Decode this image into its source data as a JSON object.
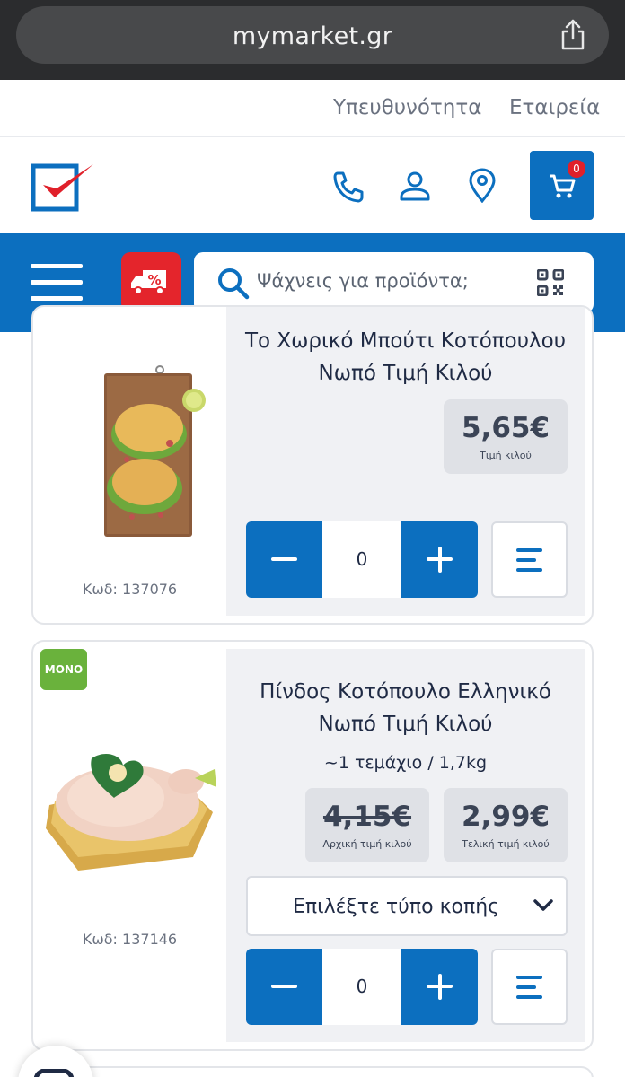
{
  "browser": {
    "url": "mymarket.gr"
  },
  "top_links": {
    "responsibility": "Υπευθυνότητα",
    "company": "Εταιρεία"
  },
  "header": {
    "cart_count": "0"
  },
  "search": {
    "placeholder": "Ψάχνεις για προϊόντα;"
  },
  "products": [
    {
      "title": "Το Χωρικό Μπούτι Κοτόπουλου Νωπό Τιμή Κιλού",
      "title_line1": "Το Χωρικό Μπούτι Κοτόπουλου",
      "title_line2": "Νωπό Τιμή Κιλού",
      "price": "5,65€",
      "price_label": "Τιμή κιλού",
      "quantity": "0",
      "code": "Κωδ: 137076"
    },
    {
      "badge": "MONO",
      "title_line1": "Πίνδος Κοτόπουλο Ελληνικό",
      "title_line2": "Νωπό Τιμή Κιλού",
      "weight": "~1 τεμάχιο / 1,7kg",
      "old_price": "4,15€",
      "old_price_label": "Αρχική τιμή κιλού",
      "final_price": "2,99€",
      "final_price_label": "Τελική τιμή κιλού",
      "cut_select": "Επιλέξτε τύπο κοπής",
      "quantity": "0",
      "code": "Κωδ: 137146"
    }
  ],
  "colors": {
    "brand_blue": "#0c6fbf",
    "delivery_red": "#e4252c",
    "mono_green": "#6ab23c"
  }
}
